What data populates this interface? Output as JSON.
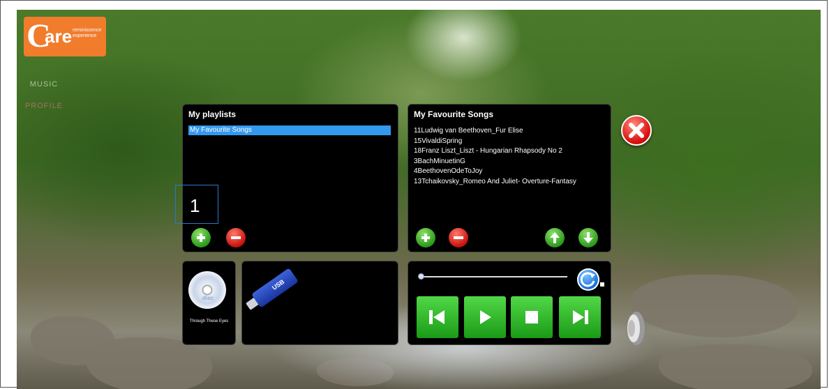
{
  "logo": {
    "letter": "C",
    "word": "are",
    "tagline": "reminiscence experience"
  },
  "side_buttons": [
    "MUSIC",
    "PROFILE"
  ],
  "playlists": {
    "title": "My playlists",
    "items": [
      "My Favourite Songs"
    ],
    "selected_index": 0
  },
  "annotation_label": "1",
  "favourites": {
    "title": "My Favourite Songs",
    "songs": [
      "11Ludwig van Beethoven_Fur Elise",
      "15VivaldiSpring",
      "18Franz Liszt_Liszt - Hungarian Rhapsody No 2",
      "3BachMinuetinG",
      "4BeethovenOdeToJoy",
      "13Tchaikovsky_Romeo And Juliet- Overture-Fantasy"
    ]
  },
  "cd": {
    "caption": "Through These Eyes",
    "disc_label": "disc"
  },
  "usb": {
    "label": "USB"
  },
  "player": {
    "progress": 0.0
  },
  "icons": {
    "add": "plus-icon",
    "remove": "minus-icon",
    "up": "arrow-up-icon",
    "down": "arrow-down-icon",
    "close": "close-icon",
    "refresh": "refresh-icon",
    "prev": "skip-previous-icon",
    "play": "play-icon",
    "stop": "stop-icon",
    "next": "skip-next-icon",
    "volume": "speaker-icon"
  },
  "colors": {
    "accent": "#3399ee",
    "green": "#2c9a1c",
    "red": "#c8120e",
    "logo": "#f07c2c"
  }
}
